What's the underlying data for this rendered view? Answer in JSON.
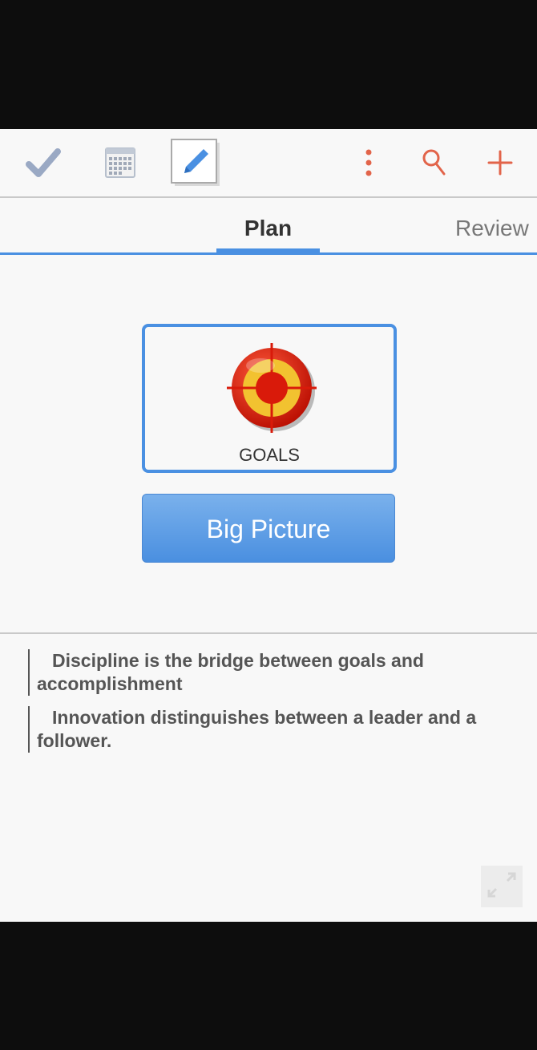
{
  "toolbar": {
    "items": [
      {
        "icon": "checkmark-icon"
      },
      {
        "icon": "calendar-icon"
      },
      {
        "icon": "edit-pencil-icon"
      },
      {
        "icon": "more-vert-icon"
      },
      {
        "icon": "search-icon"
      },
      {
        "icon": "add-icon"
      }
    ]
  },
  "tabs": [
    {
      "label": "Plan",
      "active": true
    },
    {
      "label": "Review",
      "active": false
    }
  ],
  "goal_card": {
    "icon": "target-icon",
    "label": "GOALS"
  },
  "big_picture_button": {
    "label": "Big Picture"
  },
  "quotes": [
    "Discipline is the bridge between goals and accomplishment",
    "Innovation distinguishes between a leader and a follower."
  ],
  "colors": {
    "accent": "#4a90e2",
    "icon_orange": "#e2644a",
    "target_red": "#d91a0a",
    "target_yellow": "#f2c230"
  }
}
